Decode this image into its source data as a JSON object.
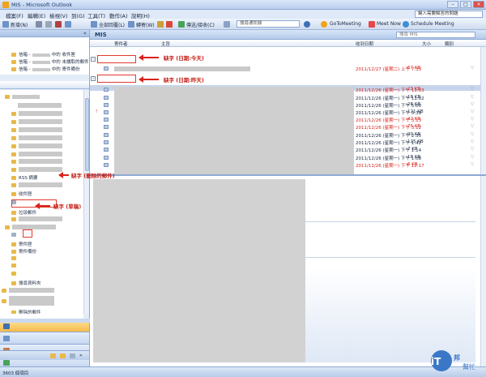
{
  "window": {
    "title": "MIS - Microsoft Outlook"
  },
  "menu": {
    "items": [
      "檔案(F)",
      "編輯(E)",
      "檢視(V)",
      "到(G)",
      "工具(T)",
      "動作(A)",
      "說明(H)"
    ],
    "help_placeholder": "鍵入需要解答的問題"
  },
  "toolbar": {
    "new": "新增(N)",
    "reply_all": "全部回覆(L)",
    "forward": "轉寄(W)",
    "send_receive": "傳送/接收(C)",
    "search_placeholder": "搜尋通訊錄",
    "gotomeeting": "GoToMeeting",
    "meet_now": "Meet Now",
    "schedule": "Schedule Meeting"
  },
  "nav": {
    "favorites": [
      {
        "left": "信箱 -",
        "right": "中的 收件匣"
      },
      {
        "left": "信箱 -",
        "right": "中的 未讀取的郵件"
      },
      {
        "left": "信箱 -",
        "right": "中的 寄件備份"
      }
    ],
    "tree": [
      "RSS 摘要",
      "收件匣",
      "垃圾郵件",
      "草稿",
      "寄件匣",
      "寄件備份",
      "搜尋資料夾",
      "刪除的郵件",
      "寄件備份",
      "收件匣"
    ]
  },
  "list": {
    "folder_name": "MIS",
    "search_placeholder": "搜尋 MIS",
    "columns": {
      "from": "寄件者",
      "subject": "主旨",
      "received": "收到日期",
      "size": "大小",
      "category": "類別"
    },
    "rows": [
      {
        "date": "2011/12/27 (星期二) 上午 7:33",
        "size": "67 KB",
        "color": "red"
      },
      {
        "date": "2011/12/26 (星期一) 下午 11:03",
        "size": "23 KB",
        "color": "red"
      },
      {
        "date": "2011/12/26 (星期一) 下午 11:02",
        "size": "18 KB",
        "color": "black"
      },
      {
        "date": "2011/12/26 (星期一) 下午 5:00",
        "size": "28 KB",
        "color": "black"
      },
      {
        "date": "2011/12/26 (星期一) 下午 3:39",
        "size": "121 KB",
        "color": "black"
      },
      {
        "date": "2011/12/26 (星期一) 下午 3:13",
        "size": "42 KB",
        "color": "red"
      },
      {
        "date": "2011/12/26 (星期一) 下午 3:12",
        "size": "75 KB",
        "color": "red"
      },
      {
        "date": "2011/12/26 (星期一) 下午 2:35",
        "size": "90 KB",
        "color": "black"
      },
      {
        "date": "2011/12/26 (星期一) 下午 1:42",
        "size": "125 KB",
        "color": "black"
      },
      {
        "date": "2011/12/26 (星期一) 下午 1:14",
        "size": "7 KB",
        "color": "black"
      },
      {
        "date": "2011/12/26 (星期一) 下午 1:08",
        "size": "18 KB",
        "color": "black"
      },
      {
        "date": "2011/12/26 (星期一) 下午 12:17",
        "size": "6 KB",
        "color": "red"
      }
    ]
  },
  "annotations": {
    "today": "缺字 (日期:今天)",
    "yesterday": "缺字 (日期:昨天)",
    "deleted": "缺字 (刪除的郵件)",
    "drafts": "缺字 (草稿)"
  },
  "status": {
    "items": "3603 個項目"
  },
  "logo": {
    "text": "iT邦幫忙"
  },
  "colors": {
    "accent": "#d8231a",
    "frame": "#8ea9d3"
  }
}
